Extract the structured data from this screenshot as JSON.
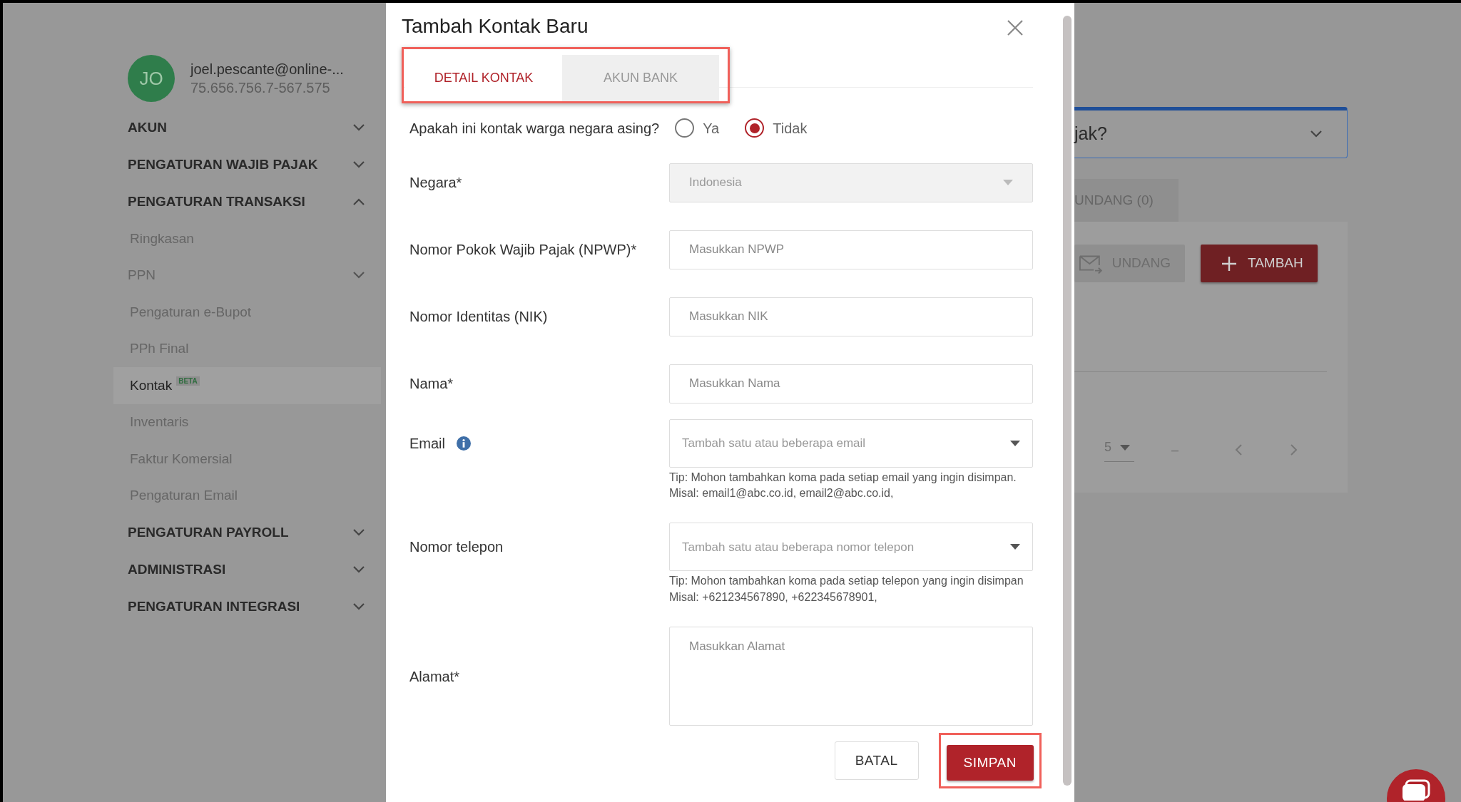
{
  "sidebar": {
    "avatar_initials": "JO",
    "email": "joel.pescante@online-...",
    "npwp": "75.656.756.7-567.575",
    "sections": [
      {
        "label": "AKUN",
        "expanded": false
      },
      {
        "label": "PENGATURAN WAJIB PAJAK",
        "expanded": false
      },
      {
        "label": "PENGATURAN TRANSAKSI",
        "expanded": true,
        "children": [
          {
            "label": "Ringkasan",
            "kind": "link",
            "selected": false
          },
          {
            "label": "PPN",
            "kind": "group",
            "expanded": false,
            "selected": false
          },
          {
            "label": "Pengaturan e-Bupot",
            "kind": "link",
            "selected": false
          },
          {
            "label": "PPh Final",
            "kind": "link",
            "selected": false
          },
          {
            "label": "Kontak",
            "kind": "link",
            "badge": "BETA",
            "selected": true
          },
          {
            "label": "Inventaris",
            "kind": "link",
            "selected": false
          },
          {
            "label": "Faktur Komersial",
            "kind": "link",
            "selected": false
          },
          {
            "label": "Pengaturan Email",
            "kind": "link",
            "selected": false
          }
        ]
      },
      {
        "label": "PENGATURAN PAYROLL",
        "expanded": false
      },
      {
        "label": "ADMINISTRASI",
        "expanded": false
      },
      {
        "label": "PENGATURAN INTEGRASI",
        "expanded": false
      }
    ]
  },
  "background": {
    "dropdown_text": "jak?",
    "tab_label": "UNDANG (0)",
    "buttons": [
      {
        "label": "UNDANG",
        "kind": "secondary"
      },
      {
        "label": "TAMBAH",
        "kind": "primary"
      }
    ],
    "pagination": {
      "page_size": "5",
      "range": "–"
    }
  },
  "modal": {
    "title": "Tambah Kontak Baru",
    "tabs_highlighted": true,
    "tabs": [
      {
        "label": "DETAIL KONTAK",
        "selected": true
      },
      {
        "label": "AKUN BANK",
        "selected": false
      }
    ],
    "foreign_question": {
      "label": "Apakah ini kontak warga negara asing?",
      "options": [
        {
          "label": "Ya",
          "selected": false
        },
        {
          "label": "Tidak",
          "selected": true
        }
      ]
    },
    "fields": [
      {
        "kind": "select",
        "label": "Negara*",
        "value": "Indonesia",
        "disabled": true,
        "info": false
      },
      {
        "kind": "input",
        "label": "Nomor Pokok Wajib Pajak (NPWP)*",
        "placeholder": "Masukkan NPWP",
        "disabled": false,
        "info": false
      },
      {
        "kind": "input",
        "label": "Nomor Identitas (NIK)",
        "placeholder": "Masukkan NIK",
        "disabled": false,
        "info": false
      },
      {
        "kind": "input",
        "label": "Nama*",
        "placeholder": "Masukkan Nama",
        "disabled": false,
        "info": false
      },
      {
        "kind": "multiselect",
        "label": "Email",
        "placeholder": "Tambah satu atau beberapa email",
        "tip": "Tip: Mohon tambahkan koma pada setiap email yang ingin disimpan. Misal: email1@abc.co.id, email2@abc.co.id,",
        "disabled": false,
        "info": true
      },
      {
        "kind": "multiselect",
        "label": "Nomor telepon",
        "placeholder": "Tambah satu atau beberapa nomor telepon",
        "tip": "Tip: Mohon tambahkan koma pada setiap telepon yang ingin disimpan Misal: +621234567890, +622345678901,",
        "disabled": false,
        "info": false
      },
      {
        "kind": "textarea",
        "label": "Alamat*",
        "placeholder": "Masukkan Alamat",
        "disabled": false,
        "info": false
      }
    ],
    "buttons": [
      {
        "label": "BATAL",
        "kind": "secondary",
        "highlighted": false
      },
      {
        "label": "SIMPAN",
        "kind": "primary",
        "highlighted": true
      }
    ]
  }
}
